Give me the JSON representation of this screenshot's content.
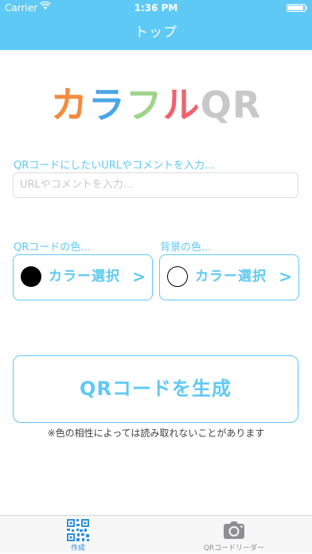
{
  "status_bar": {
    "carrier": "Carrier",
    "wifi_icon": "wifi-icon",
    "time": "1:36 PM",
    "battery_icon": "battery-icon"
  },
  "nav": {
    "title": "トップ"
  },
  "logo": {
    "chars": [
      {
        "text": "カ",
        "color": "#f68a3c"
      },
      {
        "text": "ラ",
        "color": "#4aa6e6"
      },
      {
        "text": "フ",
        "color": "#9ed58a"
      },
      {
        "text": "ル",
        "color": "#f0626e"
      },
      {
        "text": "Q",
        "color": "#c8c8c8"
      },
      {
        "text": "R",
        "color": "#c8c8c8"
      }
    ]
  },
  "input_section": {
    "label": "QRコードにしたいURLやコメントを入力...",
    "placeholder": "URLやコメントを入力..."
  },
  "qr_color": {
    "label": "QRコードの色...",
    "swatch_color": "#000000",
    "button_label": "カラー選択",
    "chevron": ">"
  },
  "bg_color": {
    "label": "背景の色...",
    "swatch_color": "#ffffff",
    "button_label": "カラー選択",
    "chevron": ">"
  },
  "generate": {
    "label": "QRコードを生成",
    "note": "※色の相性によっては読み取れないことがあります"
  },
  "tabs": [
    {
      "label": "作成",
      "icon": "qr-code-icon",
      "active": true
    },
    {
      "label": "QRコードリーダー",
      "icon": "camera-icon",
      "active": false
    }
  ],
  "colors": {
    "accent": "#5fc9f5",
    "tab_active": "#2f8fd8",
    "tab_inactive": "#8e8e93"
  }
}
